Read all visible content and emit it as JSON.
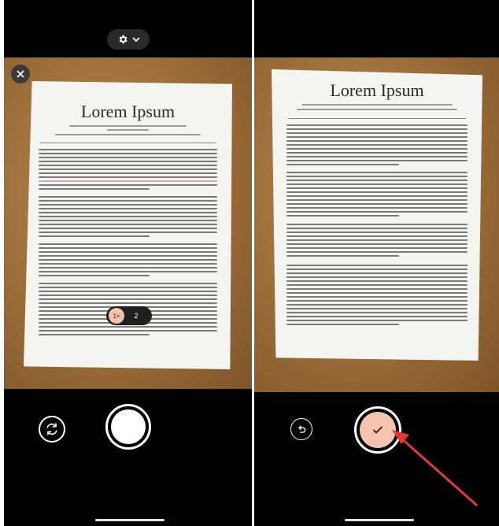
{
  "camera_screen": {
    "document_title": "Lorem Ipsum",
    "settings_icon": "gear-icon",
    "settings_dropdown_icon": "chevron-down-icon",
    "close_icon": "close-icon",
    "zoom": {
      "options": [
        "1×",
        "2"
      ],
      "selected": "1×"
    }
  },
  "review_screen": {
    "document_title": "Lorem Ipsum",
    "undo_icon": "undo-icon",
    "confirm_icon": "checkmark-icon"
  },
  "colors": {
    "accent": "#f6c3af",
    "annotation_arrow": "#e53935",
    "background": "#000000",
    "surface": "#b98e57"
  }
}
